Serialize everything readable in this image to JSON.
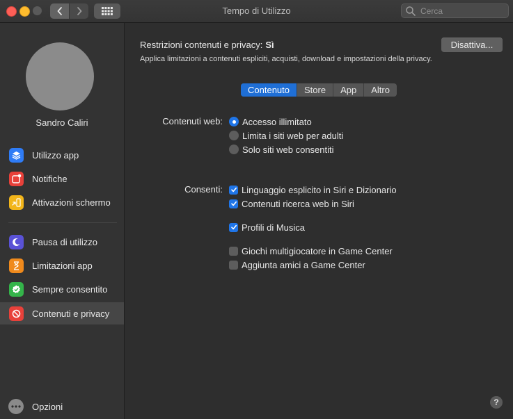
{
  "window": {
    "title": "Tempo di Utilizzo"
  },
  "search": {
    "placeholder": "Cerca",
    "value": ""
  },
  "sidebar": {
    "user_name": "Sandro Caliri",
    "items": [
      {
        "label": "Utilizzo app",
        "icon": "layers-icon",
        "color": "#2f7cf6"
      },
      {
        "label": "Notifiche",
        "icon": "notification-icon",
        "color": "#e8413a"
      },
      {
        "label": "Attivazioni schermo",
        "icon": "pickup-icon",
        "color": "#f2b51a"
      },
      {
        "label": "Pausa di utilizzo",
        "icon": "downtime-icon",
        "color": "#5a52d6"
      },
      {
        "label": "Limitazioni app",
        "icon": "hourglass-icon",
        "color": "#f08a1c"
      },
      {
        "label": "Sempre consentito",
        "icon": "check-badge-icon",
        "color": "#34b44a"
      },
      {
        "label": "Contenuti e privacy",
        "icon": "no-entry-icon",
        "color": "#e8413a"
      }
    ],
    "options_label": "Opzioni"
  },
  "main": {
    "restrictions_label": "Restrizioni contenuti e privacy:",
    "restrictions_value": "Sì",
    "description": "Applica limitazioni a contenuti espliciti, acquisti, download e impostazioni della privacy.",
    "disable_button": "Disattiva...",
    "tabs": [
      {
        "label": "Contenuto",
        "active": true
      },
      {
        "label": "Store",
        "active": false
      },
      {
        "label": "App",
        "active": false
      },
      {
        "label": "Altro",
        "active": false
      }
    ],
    "web_content": {
      "label": "Contenuti web:",
      "options": [
        {
          "label": "Accesso illimitato",
          "selected": true
        },
        {
          "label": "Limita i siti web per adulti",
          "selected": false
        },
        {
          "label": "Solo siti web consentiti",
          "selected": false
        }
      ]
    },
    "allow": {
      "label": "Consenti:",
      "options": [
        {
          "label": "Linguaggio esplicito in Siri e Dizionario",
          "checked": true
        },
        {
          "label": "Contenuti ricerca web in Siri",
          "checked": true
        },
        {
          "label": "Profili di Musica",
          "checked": true
        },
        {
          "label": "Giochi multigiocatore in Game Center",
          "checked": false
        },
        {
          "label": "Aggiunta amici a Game Center",
          "checked": false
        }
      ]
    },
    "help_label": "?"
  }
}
